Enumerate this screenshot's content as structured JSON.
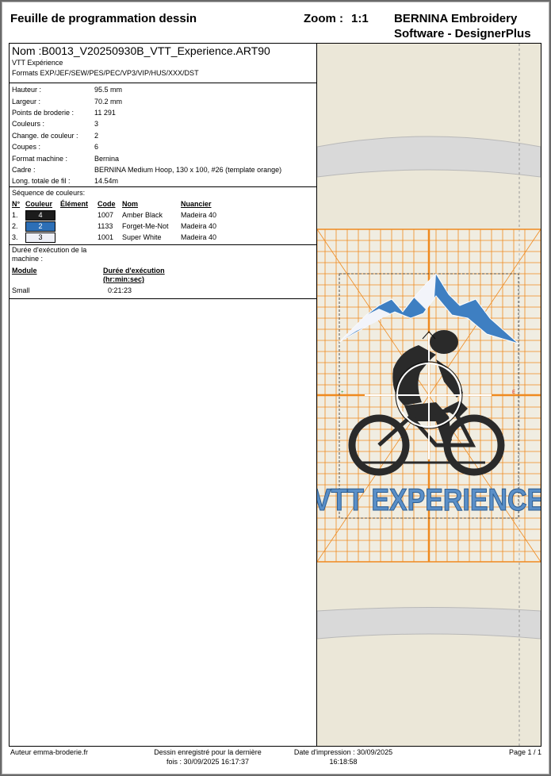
{
  "header": {
    "sheet_title": "Feuille de programmation dessin",
    "zoom_label": "Zoom :",
    "zoom_value": "1:1",
    "brand_line1": "BERNINA Embroidery",
    "brand_line2": "Software - DesignerPlus"
  },
  "design": {
    "name_label": "Nom :",
    "name_value": "B0013_V20250930B_VTT_Experience.ART90",
    "subtitle": "VTT Expérience",
    "formats": "Formats EXP/JEF/SEW/PES/PEC/VP3/VIP/HUS/XXX/DST"
  },
  "properties": [
    {
      "label": "Hauteur :",
      "value": "95.5 mm"
    },
    {
      "label": "Largeur :",
      "value": "70.2 mm"
    },
    {
      "label": "Points de broderie :",
      "value": "11 291"
    },
    {
      "label": "Couleurs :",
      "value": "3"
    },
    {
      "label": "Change. de couleur :",
      "value": "2"
    },
    {
      "label": "Coupes :",
      "value": "6"
    },
    {
      "label": "Format machine :",
      "value": "Bernina"
    },
    {
      "label": "Cadre :",
      "value": "BERNINA Medium Hoop, 130 x 100, #26 (template orange)"
    },
    {
      "label": "Long. totale de fil :",
      "value": "14.54m"
    }
  ],
  "color_sequence": {
    "title": "Séquence de couleurs:",
    "headers": {
      "no": "N°",
      "couleur": "Couleur",
      "element": "Élément",
      "code": "Code",
      "nom": "Nom",
      "nuancier": "Nuancier"
    },
    "rows": [
      {
        "no": "1.",
        "swatch_label": "4",
        "swatch_color": "#1c1c1c",
        "text_color": "#ffffff",
        "code": "1007",
        "nom": "Amber Black",
        "nuancier": "Madeira 40"
      },
      {
        "no": "2.",
        "swatch_label": "2",
        "swatch_color": "#2d6fb6",
        "text_color": "#ffffff",
        "code": "1133",
        "nom": "Forget-Me-Not",
        "nuancier": "Madeira 40"
      },
      {
        "no": "3.",
        "swatch_label": "3",
        "swatch_color": "#eef0f7",
        "text_color": "#000000",
        "code": "1001",
        "nom": "Super White",
        "nuancier": "Madeira 40"
      }
    ]
  },
  "execution": {
    "title_line1": "Durée d'exécution de la",
    "title_line2": "machine :",
    "col_module": "Module",
    "col_duration_line1": "Durée d'exécution",
    "col_duration_line2": "(hr:min:sec)",
    "rows": [
      {
        "module": "Small",
        "duration": "0:21:23"
      }
    ]
  },
  "preview": {
    "design_text": "VTT EXPERIENCE",
    "hoop_color": "#ef8a1f",
    "fabric_color": "#ebe7d8"
  },
  "footer": {
    "author": "Auteur emma-broderie.fr",
    "saved_line1": "Dessin enregistré pour la dernière",
    "saved_line2": "fois : 30/09/2025 16:17:37",
    "print_line1": "Date d'impression : 30/09/2025",
    "print_line2": "16:18:58",
    "page": "Page 1 / 1"
  }
}
